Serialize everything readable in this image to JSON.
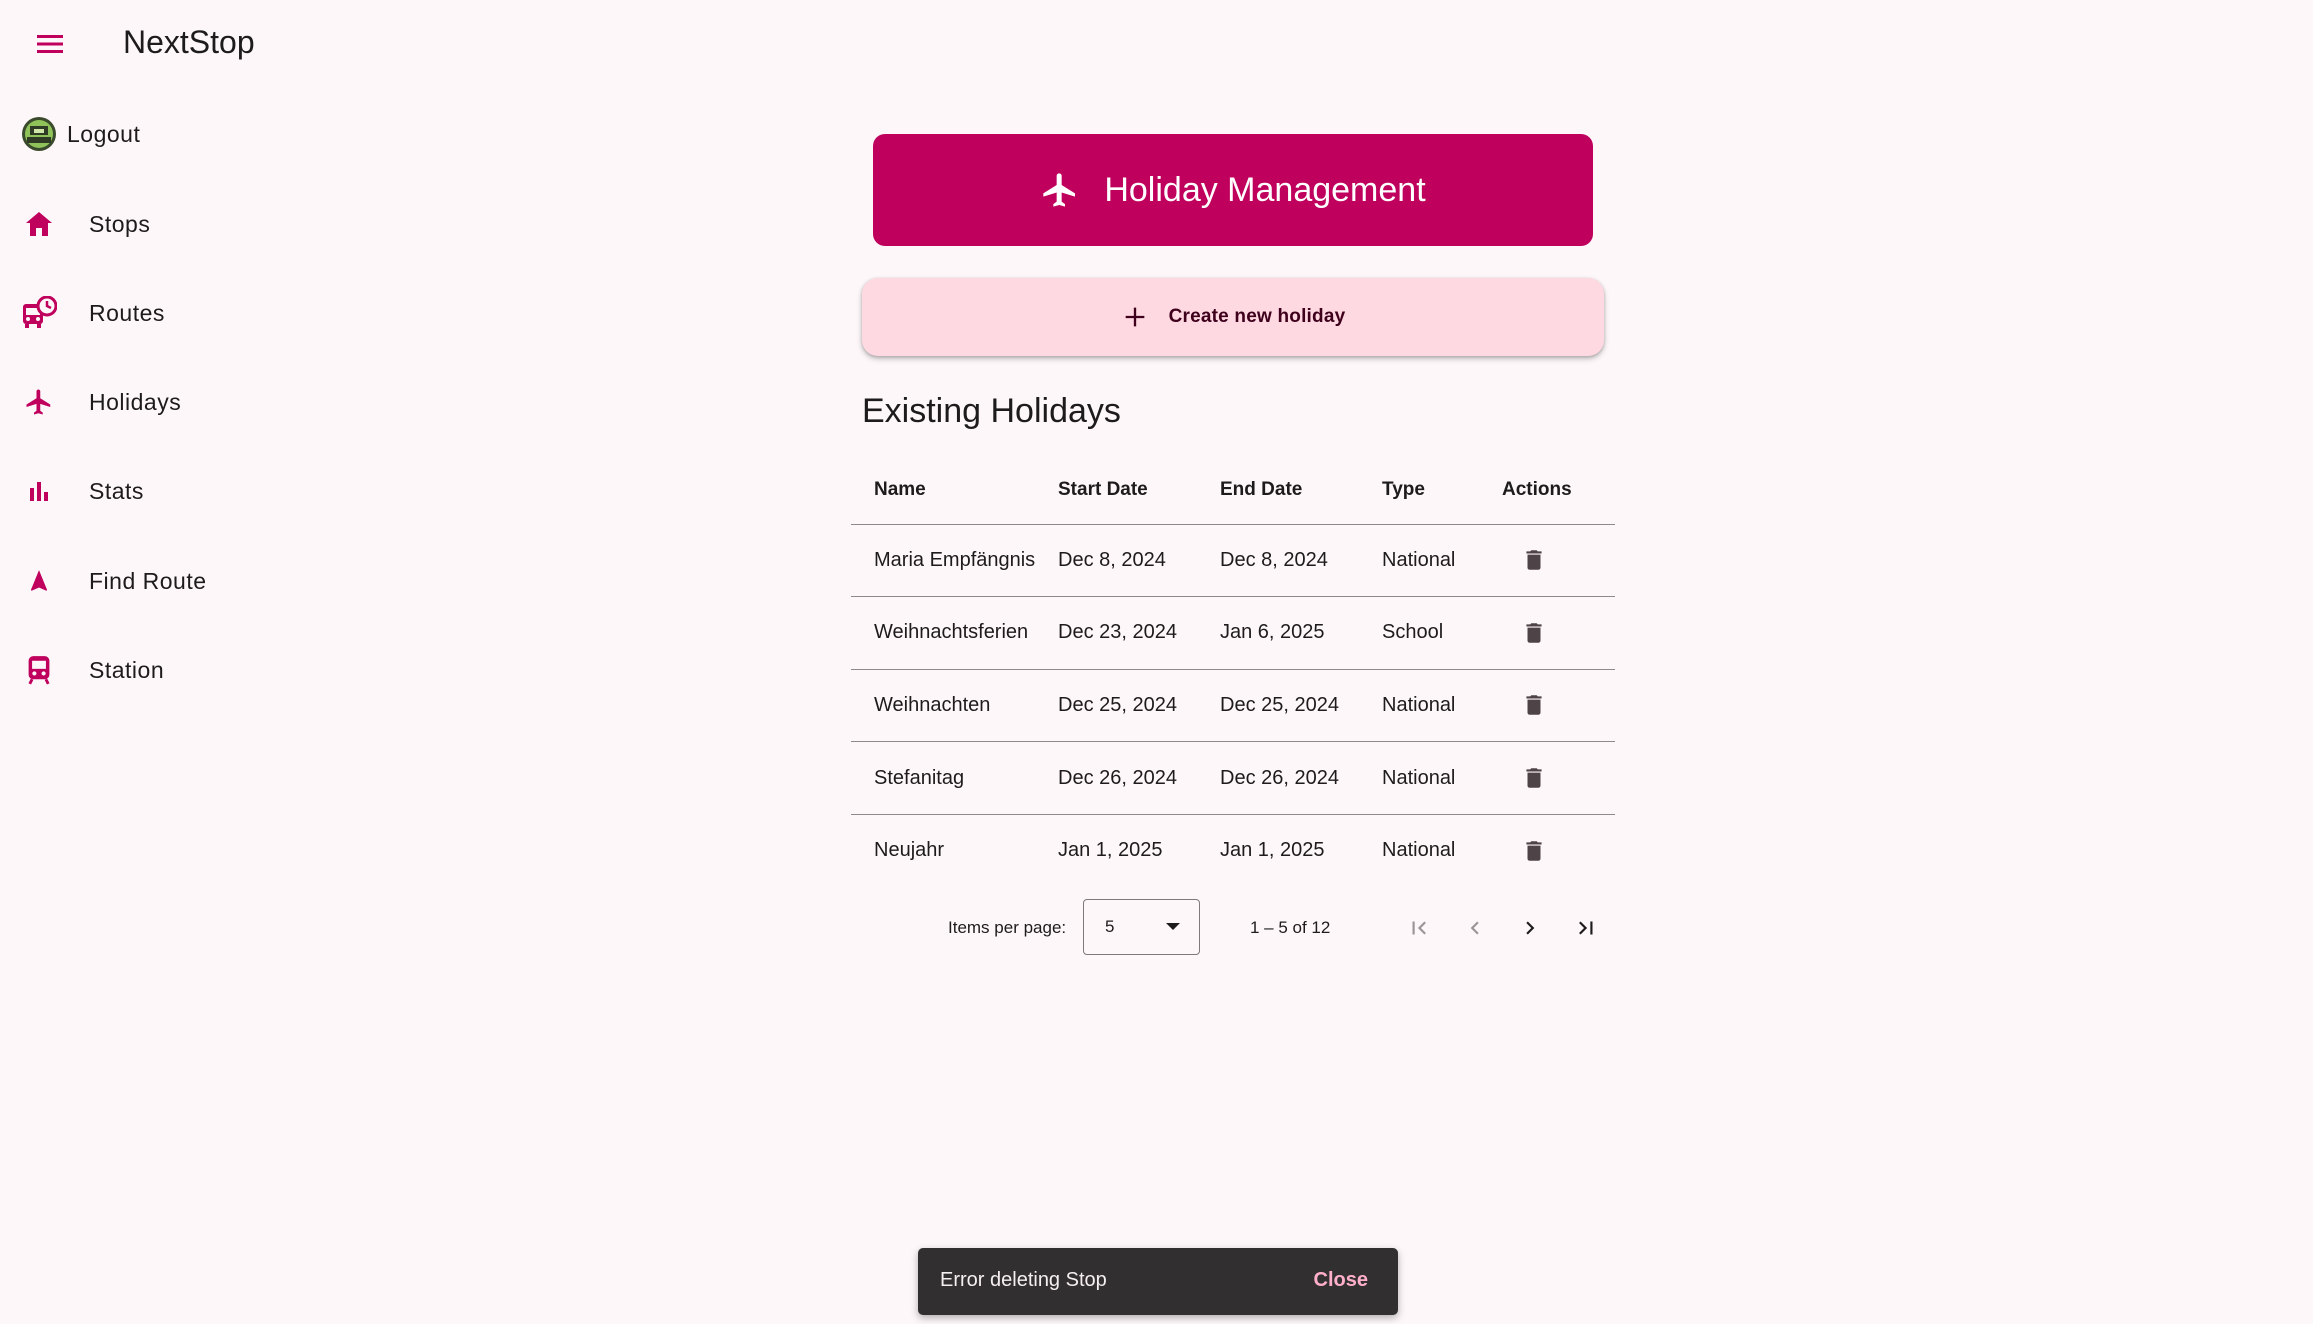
{
  "app": {
    "title": "NextStop"
  },
  "colors": {
    "primary": "#bf005d",
    "secondary_container": "#ffd9e2",
    "background": "#fdf7f9",
    "snackbar": "#322f31"
  },
  "sidebar": {
    "items": [
      {
        "label": "Logout",
        "icon": "avatar-icon"
      },
      {
        "label": "Stops",
        "icon": "home-icon"
      },
      {
        "label": "Routes",
        "icon": "bus-clock-icon"
      },
      {
        "label": "Holidays",
        "icon": "airplane-icon"
      },
      {
        "label": "Stats",
        "icon": "bar-chart-icon"
      },
      {
        "label": "Find Route",
        "icon": "navigation-icon"
      },
      {
        "label": "Station",
        "icon": "train-icon"
      }
    ]
  },
  "header": {
    "title": "Holiday Management",
    "icon": "airplane-icon"
  },
  "create_button": {
    "label": "Create new holiday",
    "icon": "plus-icon"
  },
  "section": {
    "title": "Existing Holidays"
  },
  "table": {
    "columns": [
      "Name",
      "Start Date",
      "End Date",
      "Type",
      "Actions"
    ],
    "rows": [
      {
        "name": "Maria Empfängnis",
        "start": "Dec 8, 2024",
        "end": "Dec 8, 2024",
        "type": "National"
      },
      {
        "name": "Weihnachtsferien",
        "start": "Dec 23, 2024",
        "end": "Jan 6, 2025",
        "type": "School"
      },
      {
        "name": "Weihnachten",
        "start": "Dec 25, 2024",
        "end": "Dec 25, 2024",
        "type": "National"
      },
      {
        "name": "Stefanitag",
        "start": "Dec 26, 2024",
        "end": "Dec 26, 2024",
        "type": "National"
      },
      {
        "name": "Neujahr",
        "start": "Jan 1, 2025",
        "end": "Jan 1, 2025",
        "type": "National"
      }
    ]
  },
  "paginator": {
    "items_per_page_label": "Items per page:",
    "items_per_page_value": "5",
    "range_label": "1 – 5 of 12"
  },
  "snackbar": {
    "message": "Error deleting Stop",
    "action": "Close"
  }
}
